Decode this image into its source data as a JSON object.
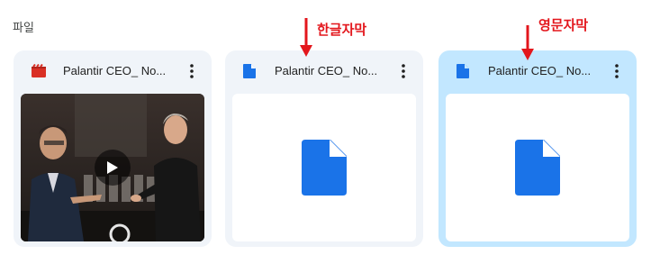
{
  "section": {
    "label": "파일"
  },
  "files": [
    {
      "title": "Palantir CEO_ No...",
      "type_icon": "video-icon",
      "thumbnail": "video",
      "selected": false
    },
    {
      "title": "Palantir CEO_ No...",
      "type_icon": "document-icon",
      "thumbnail": "document",
      "selected": false
    },
    {
      "title": "Palantir CEO_ No...",
      "type_icon": "document-icon",
      "thumbnail": "document",
      "selected": true
    }
  ],
  "annotations": {
    "korean_subtitle": "한글자막",
    "english_subtitle": "영문자막"
  },
  "colors": {
    "card_bg": "#f0f4f9",
    "card_selected_bg": "#c2e7ff",
    "doc_blue": "#1a73e8",
    "video_red": "#d93025",
    "annotation_red": "#e3161c"
  }
}
